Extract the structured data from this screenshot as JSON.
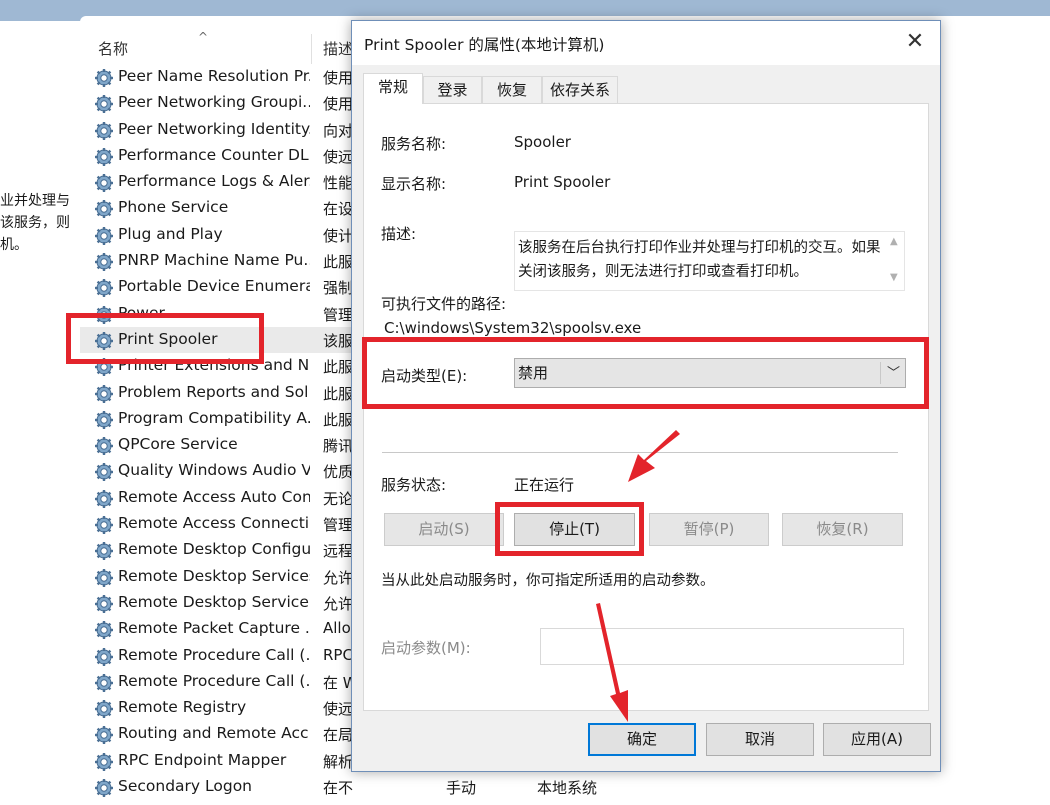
{
  "background": {
    "left_desc_text": "业并处理与\n该服务，则\n机。",
    "column_name": "名称",
    "column_desc": "描述",
    "sort_indicator": "^",
    "services": [
      {
        "name": "Peer Name Resolution Pr...",
        "desc": "使用"
      },
      {
        "name": "Peer Networking Groupi...",
        "desc": "使用"
      },
      {
        "name": "Peer Networking Identity...",
        "desc": "向对"
      },
      {
        "name": "Performance Counter DL...",
        "desc": "使远"
      },
      {
        "name": "Performance Logs & Aler...",
        "desc": "性能"
      },
      {
        "name": "Phone Service",
        "desc": "在设"
      },
      {
        "name": "Plug and Play",
        "desc": "使计"
      },
      {
        "name": "PNRP Machine Name Pu...",
        "desc": "此服"
      },
      {
        "name": "Portable Device Enumera...",
        "desc": "强制"
      },
      {
        "name": "Power",
        "desc": "管理"
      },
      {
        "name": "Print Spooler",
        "desc": "该服",
        "selected": true
      },
      {
        "name": "Printer Extensions and N...",
        "desc": "此服"
      },
      {
        "name": "Problem Reports and Sol...",
        "desc": "此服"
      },
      {
        "name": "Program Compatibility A...",
        "desc": "此服"
      },
      {
        "name": "QPCore Service",
        "desc": "腾讯"
      },
      {
        "name": "Quality Windows Audio V...",
        "desc": "优质"
      },
      {
        "name": "Remote Access Auto Con...",
        "desc": "无论"
      },
      {
        "name": "Remote Access Connecti...",
        "desc": "管理"
      },
      {
        "name": "Remote Desktop Configu...",
        "desc": "远程"
      },
      {
        "name": "Remote Desktop Services",
        "desc": "允许"
      },
      {
        "name": "Remote Desktop Service...",
        "desc": "允许"
      },
      {
        "name": "Remote Packet Capture ...",
        "desc": "Allo"
      },
      {
        "name": "Remote Procedure Call (...",
        "desc": "RPC"
      },
      {
        "name": "Remote Procedure Call (...",
        "desc": "在 W"
      },
      {
        "name": "Remote Registry",
        "desc": "使远"
      },
      {
        "name": "Routing and Remote Acc...",
        "desc": "在局"
      },
      {
        "name": "RPC Endpoint Mapper",
        "desc": "解析"
      },
      {
        "name": "Secondary Logon",
        "desc": "在不...",
        "startup": "手动",
        "logon": "本地系统"
      }
    ]
  },
  "dialog": {
    "title": "Print Spooler 的属性(本地计算机)",
    "close_glyph": "✕",
    "tabs": [
      "常规",
      "登录",
      "恢复",
      "依存关系"
    ],
    "service_name_label": "服务名称:",
    "service_name": "Spooler",
    "display_name_label": "显示名称:",
    "display_name": "Print Spooler",
    "description_label": "描述:",
    "description": "该服务在后台执行打印作业并处理与打印机的交互。如果关闭该服务，则无法进行打印或查看打印机。",
    "path_label": "可执行文件的路径:",
    "path": "C:\\windows\\System32\\spoolsv.exe",
    "startup_type_label": "启动类型(E):",
    "startup_type": "禁用",
    "status_label": "服务状态:",
    "status": "正在运行",
    "btn_start": "启动(S)",
    "btn_stop": "停止(T)",
    "btn_pause": "暂停(P)",
    "btn_resume": "恢复(R)",
    "hint": "当从此处启动服务时，你可指定所适用的启动参数。",
    "params_label": "启动参数(M):",
    "params_value": "",
    "btn_ok": "确定",
    "btn_cancel": "取消",
    "btn_apply": "应用(A)"
  },
  "colors": {
    "annotation_red": "#e3242b",
    "focus_blue": "#0078d7",
    "dialog_bg": "#f0f0f0"
  }
}
